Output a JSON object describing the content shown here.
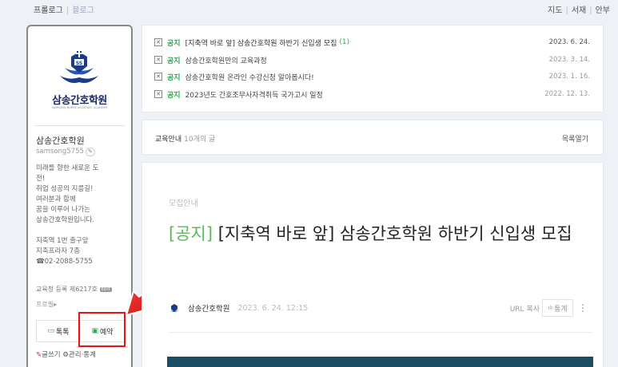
{
  "topbar": {
    "prologue": "프롤로그",
    "blog": "블로그",
    "links": [
      "지도",
      "서재",
      "안부"
    ]
  },
  "profile": {
    "logo_text": "삼송간호학원",
    "logo_sub": "SAMSONG NURSE ASSISTANT ACADEMY",
    "name": "삼송간호학원",
    "id": "samsong5755",
    "intro": "미래를 향한 새로운 도\n전!\n취업 성공의 지름길!\n여러분과 함께\n꿈을 이루어 나가는\n삼송간호학원입니다.\n\n지축역 1번 출구앞\n지축프라자 7층\n☎02-2088-5755",
    "license": "교육청 등록 제6217호",
    "license_badge": "EDIT",
    "prologue_label": "프로필▸",
    "talk_label": "톡톡",
    "reserve_label": "예약",
    "write_label": "글쓰기",
    "admin_label": "관리·통계"
  },
  "notices": [
    {
      "tag": "공지",
      "title": "[지축역 바로 앞] 삼송간호학원 하반기 신입생 모집",
      "count": "(1)",
      "date": "2023. 6. 24."
    },
    {
      "tag": "공지",
      "title": "삼송간호학원만의 교육과정",
      "count": "",
      "date": "2023. 3. 14."
    },
    {
      "tag": "공지",
      "title": "삼송간호학원 온라인 수강신청 알아봅시다!",
      "count": "",
      "date": "2023. 1. 16."
    },
    {
      "tag": "공지",
      "title": "2023년도 간호조무사자격취득 국가고시 일정",
      "count": "",
      "date": "2022. 12. 13."
    }
  ],
  "category": {
    "name": "교육안내",
    "count": "10개의 글",
    "list_toggle": "목록열기"
  },
  "post": {
    "category": "모집안내",
    "title_tag": "[공지]",
    "title": " [지축역 바로 앞] 삼송간호학원 하반기 신입생 모집",
    "author": "삼송간호학원",
    "time": "2023. 6. 24. 12:15",
    "url_copy": "URL 복사",
    "stats": "통계",
    "more": "⋮"
  },
  "colors": {
    "accent_green": "#2fa84f",
    "annotation_red": "#e11111",
    "banner": "#1b4d63"
  }
}
